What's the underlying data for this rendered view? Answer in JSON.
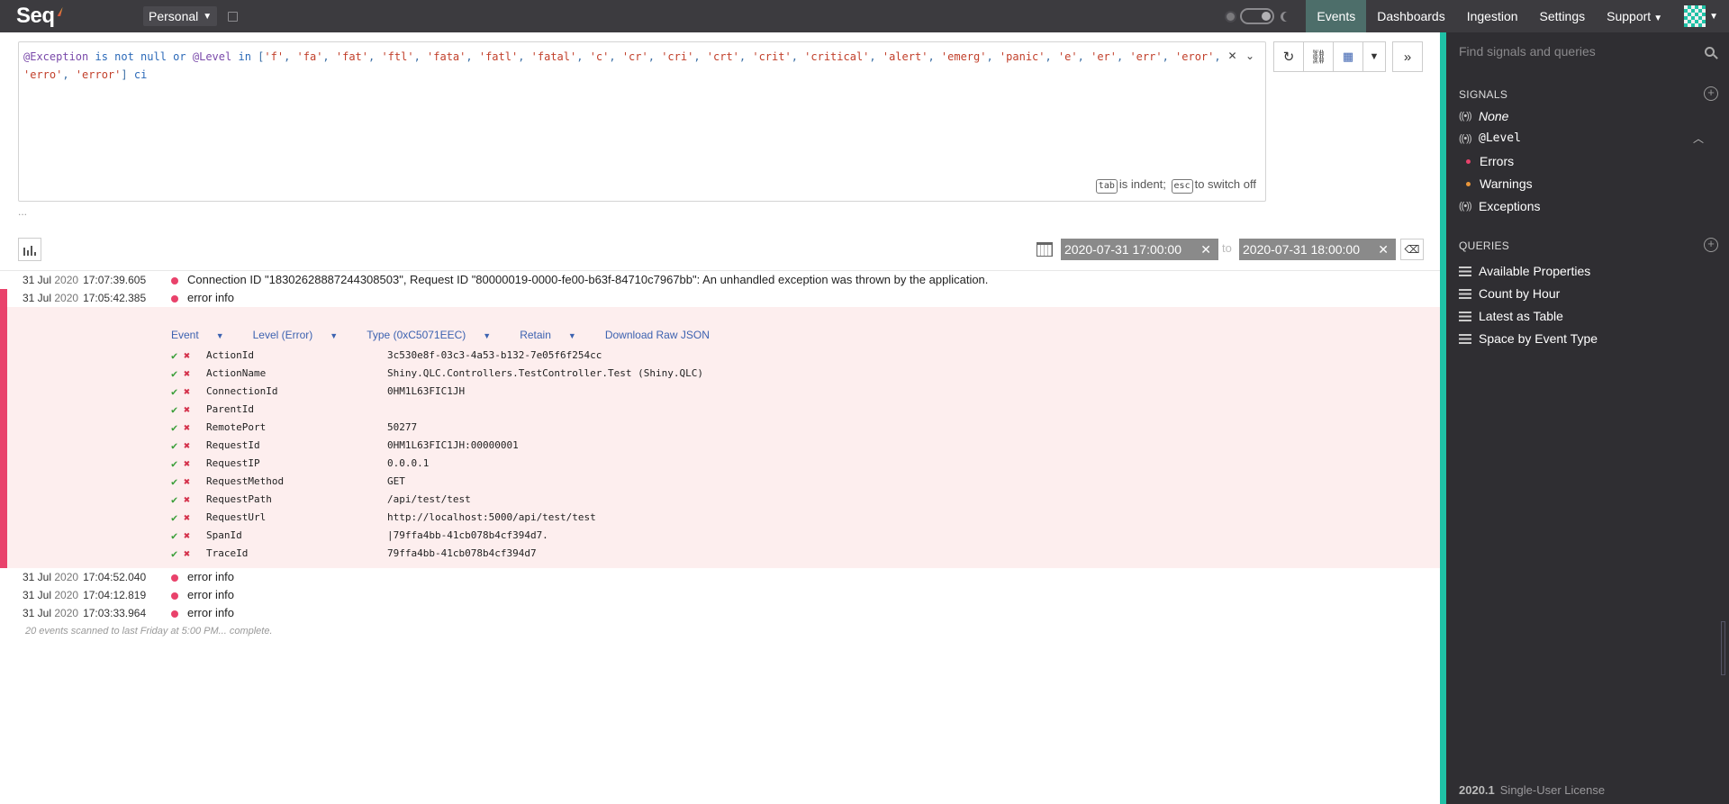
{
  "app": {
    "logo": "Seq"
  },
  "topbar": {
    "workspace": "Personal",
    "nav": [
      "Events",
      "Dashboards",
      "Ingestion",
      "Settings",
      "Support"
    ]
  },
  "query": {
    "prop1": "@Exception",
    "kw1": "is not null or",
    "prop2": "@Level",
    "kw2": "in",
    "strings": [
      "'f'",
      "'fa'",
      "'fat'",
      "'ftl'",
      "'fata'",
      "'fatl'",
      "'fatal'",
      "'c'",
      "'cr'",
      "'cri'",
      "'crt'",
      "'crit'",
      "'critical'",
      "'alert'",
      "'emerg'",
      "'panic'",
      "'e'",
      "'er'",
      "'err'",
      "'eror'",
      "'erro'",
      "'error'"
    ],
    "suffix": "ci",
    "hint_tab": "tab",
    "hint_tab_text": "is indent;",
    "hint_esc": "esc",
    "hint_esc_text": "to switch off",
    "more": "..."
  },
  "filter": {
    "from": "2020-07-31 17:00:00",
    "to_label": "to",
    "to": "2020-07-31 18:00:00"
  },
  "events": [
    {
      "date": "31 Jul",
      "year": "2020",
      "time": "17:07:39.605",
      "message": "Connection ID \"18302628887244308503\", Request ID \"80000019-0000-fe00-b63f-84710c7967bb\": An unhandled exception was thrown by the application."
    },
    {
      "date": "31 Jul",
      "year": "2020",
      "time": "17:05:42.385",
      "message": "error info"
    },
    {
      "date": "31 Jul",
      "year": "2020",
      "time": "17:04:52.040",
      "message": "error info"
    },
    {
      "date": "31 Jul",
      "year": "2020",
      "time": "17:04:12.819",
      "message": "error info"
    },
    {
      "date": "31 Jul",
      "year": "2020",
      "time": "17:03:33.964",
      "message": "error info"
    }
  ],
  "detail": {
    "tabs": [
      "Event",
      "Level (Error)",
      "Type (0xC5071EEC)",
      "Retain",
      "Download Raw JSON"
    ],
    "properties": [
      {
        "name": "ActionId",
        "value": "3c530e8f-03c3-4a53-b132-7e05f6f254cc"
      },
      {
        "name": "ActionName",
        "value": "Shiny.QLC.Controllers.TestController.Test (Shiny.QLC)"
      },
      {
        "name": "ConnectionId",
        "value": "0HM1L63FIC1JH"
      },
      {
        "name": "ParentId",
        "value": ""
      },
      {
        "name": "RemotePort",
        "value": "50277"
      },
      {
        "name": "RequestId",
        "value": "0HM1L63FIC1JH:00000001"
      },
      {
        "name": "RequestIP",
        "value": "0.0.0.1"
      },
      {
        "name": "RequestMethod",
        "value": "GET"
      },
      {
        "name": "RequestPath",
        "value": "/api/test/test"
      },
      {
        "name": "RequestUrl",
        "value": "http://localhost:5000/api/test/test"
      },
      {
        "name": "SpanId",
        "value": "|79ffa4bb-41cb078b4cf394d7."
      },
      {
        "name": "TraceId",
        "value": "79ffa4bb-41cb078b4cf394d7"
      }
    ]
  },
  "status": "20 events scanned to last Friday at 5:00 PM... complete.",
  "sidebar": {
    "search_placeholder": "Find signals and queries",
    "signals_title": "SIGNALS",
    "signals": {
      "none": "None",
      "group": "@Level",
      "errors": "Errors",
      "warnings": "Warnings",
      "exceptions": "Exceptions"
    },
    "queries_title": "QUERIES",
    "queries": [
      "Available Properties",
      "Count by Hour",
      "Latest as Table",
      "Space by Event Type"
    ],
    "version": "2020.1",
    "license": "Single-User License"
  },
  "colors": {
    "accent": "#1fc1a6",
    "error": "#e9426b",
    "warning": "#e9963a",
    "topbar": "#3c3b3f",
    "sidebar": "#2f2e32"
  },
  "icons": {
    "save": "save-icon",
    "refresh": "refresh-icon",
    "link": "link-icon",
    "layout": "layout-icon",
    "expand": "double-chevron-right-icon",
    "calendar": "calendar-icon",
    "search": "search-icon"
  }
}
